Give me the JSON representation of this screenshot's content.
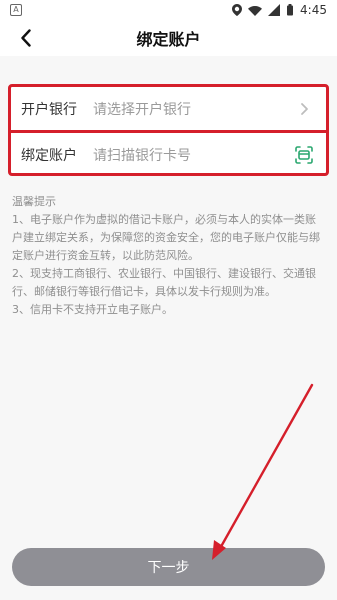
{
  "status_bar": {
    "time": "4:45",
    "left_badge": "A"
  },
  "header": {
    "title": "绑定账户",
    "back_icon": "chevron-left-icon"
  },
  "form": {
    "bank": {
      "label": "开户银行",
      "placeholder": "请选择开户银行",
      "right_icon": "chevron-right-icon"
    },
    "account": {
      "label": "绑定账户",
      "placeholder": "请扫描银行卡号",
      "right_icon": "scan-card-icon"
    }
  },
  "tips": {
    "title": "温馨提示",
    "items": [
      "1、电子账户作为虚拟的借记卡账户，必须与本人的实体一类账户建立绑定关系，为保障您的资金安全，您的电子账户仅能与绑定账户进行资金互转，以此防范风险。",
      "2、现支持工商银行、农业银行、中国银行、建设银行、交通银行、邮储银行等银行借记卡，具体以发卡行规则为准。",
      "3、信用卡不支持开立电子账户。"
    ]
  },
  "actions": {
    "next_label": "下一步"
  },
  "colors": {
    "highlight": "#d51f2b",
    "button_bg": "#8f8f95",
    "scan_icon": "#2aa76f"
  }
}
